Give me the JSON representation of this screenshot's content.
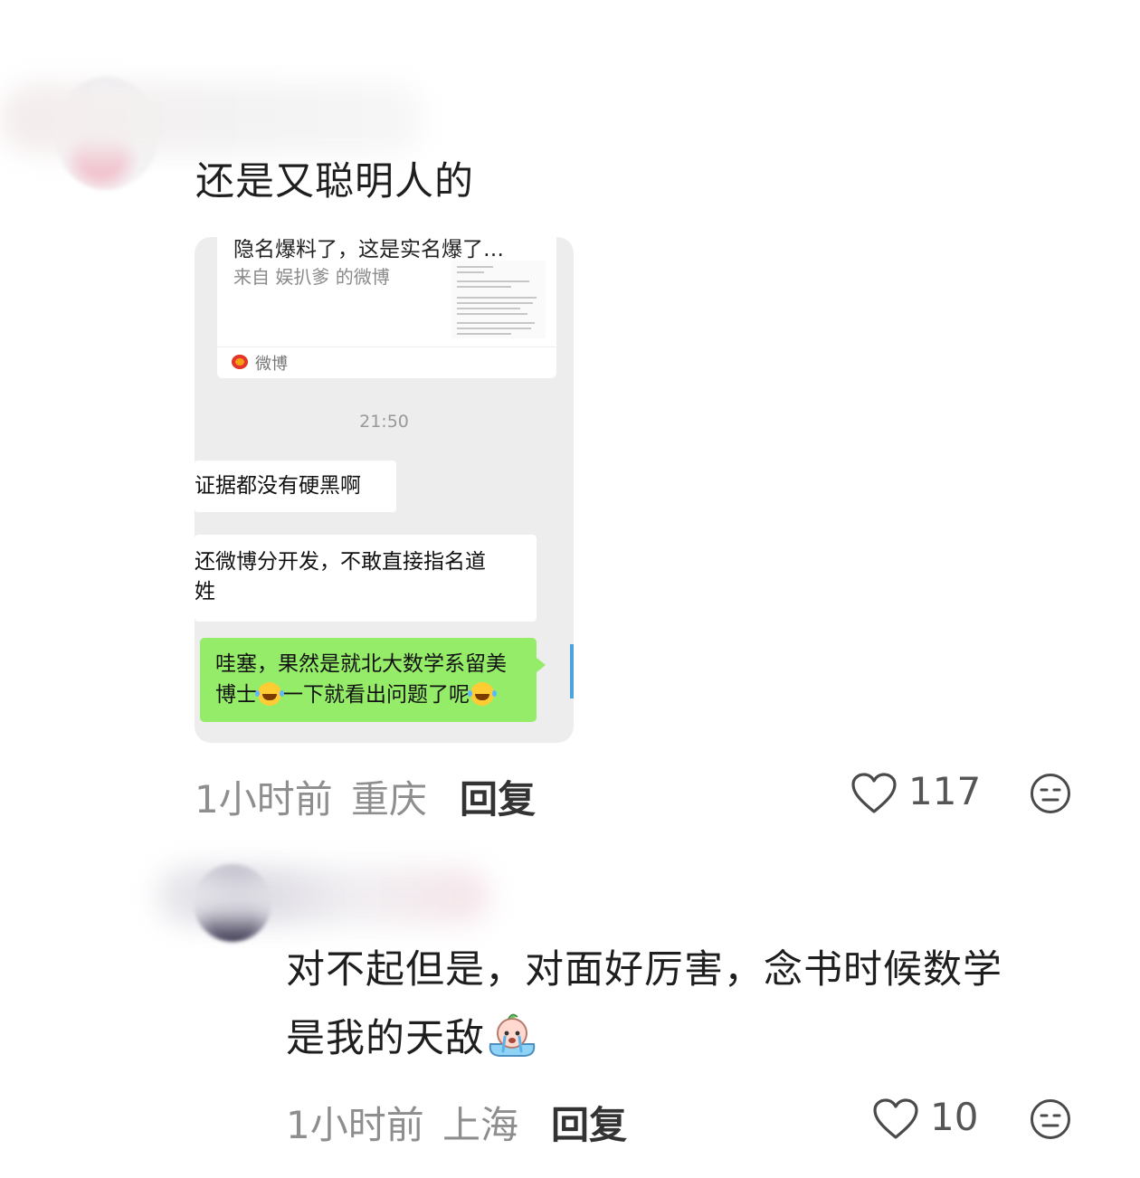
{
  "comments": [
    {
      "text": "还是又聪明人的",
      "time": "1小时前",
      "location": "重庆",
      "reply_label": "回复",
      "likes": "117"
    },
    {
      "text_line1": "对不起但是，对面好厉害，念书时候数学",
      "text_line2": "是我的天敌",
      "time": "1小时前",
      "location": "上海",
      "reply_label": "回复",
      "likes": "10"
    }
  ],
  "screenshot": {
    "link_title": "隐名爆料了，这是实名爆了…",
    "link_source": "来自 娱扒爹 的微博",
    "link_footer": "微博",
    "timestamp": "21:50",
    "msg1": "证据都没有硬黑啊",
    "msg2_line1": "还微博分开发，不敢直接指名道",
    "msg2_line2": "姓",
    "msg3_line1": "哇塞，果然是就北大数学系留美",
    "msg3_line2a": "博士",
    "msg3_line2b": "一下就看出问题了呢"
  },
  "icons": {
    "like": "heart-outline-icon",
    "dislike": "meh-face-icon",
    "laugh_emoji": "laugh-cry-emoji",
    "sticker": "crying-sticker"
  }
}
